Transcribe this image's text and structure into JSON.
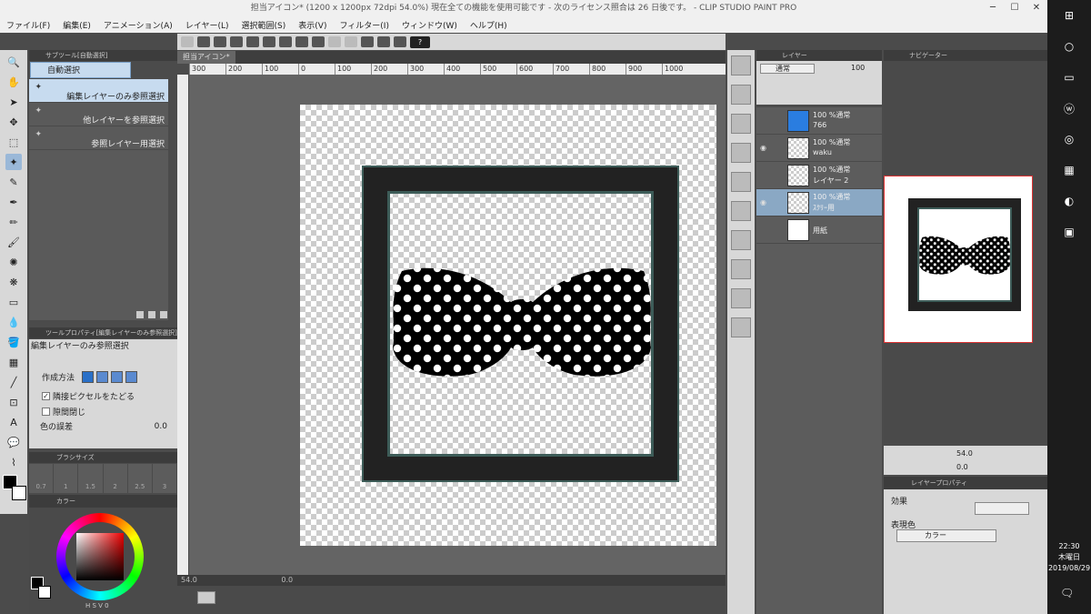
{
  "window": {
    "title": "担当アイコン* (1200 x 1200px 72dpi 54.0%)  現在全ての機能を使用可能です - 次のライセンス照合は 26 日後です。 - CLIP STUDIO PAINT PRO"
  },
  "menu": [
    "ファイル(F)",
    "編集(E)",
    "アニメーション(A)",
    "レイヤー(L)",
    "選択範囲(S)",
    "表示(V)",
    "フィルター(I)",
    "ウィンドウ(W)",
    "ヘルプ(H)"
  ],
  "subtool": {
    "header": "サブツール[自動選択]",
    "tab": "自動選択",
    "items": [
      "編集レイヤーのみ参照選択",
      "他レイヤーを参照選択",
      "参照レイヤー用選択"
    ]
  },
  "tool_property": {
    "header": "ツールプロパティ[編集レイヤーのみ参照選択]",
    "title": "編集レイヤーのみ参照選択",
    "create_method": "作成方法",
    "adjacent_pixel": "隣接ピクセルをたどる",
    "close_gap": "隙間閉じ",
    "color_error": "色の誤差",
    "color_error_value": "0.0"
  },
  "brush_size": {
    "header": "ブラシサイズ",
    "sizes": [
      "0.7",
      "1",
      "1.5",
      "2",
      "2.5",
      "3"
    ]
  },
  "color_panel": {
    "header": "カラー",
    "hsv": "H  S  V  0"
  },
  "canvas": {
    "tab": "担当アイコン*",
    "ruler": [
      "300",
      "200",
      "100",
      "0",
      "100",
      "200",
      "300",
      "400",
      "500",
      "600",
      "700",
      "800",
      "900",
      "1000"
    ],
    "zoom": "54.0",
    "angle": "0.0"
  },
  "layer_panel": {
    "header": "レイヤー",
    "blend_mode": "通常",
    "opacity": "100",
    "layers": [
      {
        "mode": "100 %通常",
        "name": "766",
        "selected": false
      },
      {
        "mode": "100 %通常",
        "name": "waku",
        "selected": false
      },
      {
        "mode": "100 %通常",
        "name": "レイヤー 2",
        "selected": false
      },
      {
        "mode": "100 %通常",
        "name": "ｽｸﾘｰ用",
        "selected": true
      },
      {
        "mode": "",
        "name": "用紙",
        "selected": false
      }
    ]
  },
  "navigator": {
    "header": "ナビゲーター",
    "zoom": "54.0",
    "angle": "0.0"
  },
  "layer_property": {
    "header": "レイヤープロパティ",
    "effect": "効果",
    "expression_color": "表現色",
    "color_option": "カラー"
  },
  "taskbar": {
    "time": "22:30",
    "day": "木曜日",
    "date": "2019/08/29"
  },
  "colors": {
    "accent": "#2a70c8",
    "selected_row": "#c7dbef",
    "frame_teal": "#3d5c58"
  }
}
